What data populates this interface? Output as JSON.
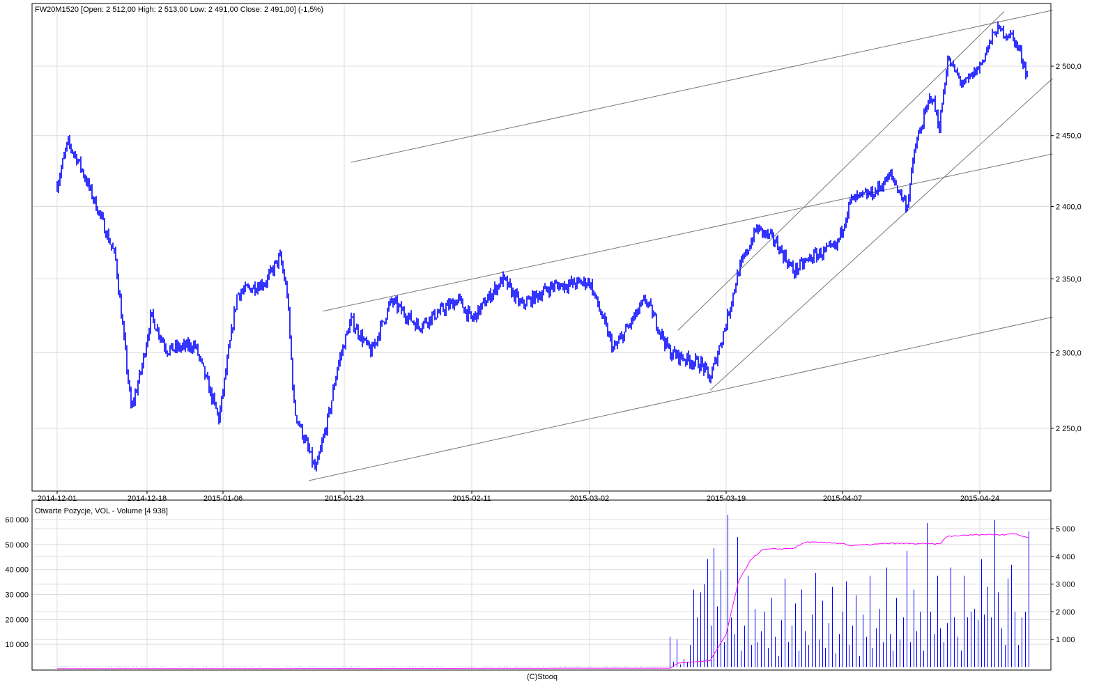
{
  "chart_data": [
    {
      "type": "candlestick",
      "title": "FW20M1520 [Open: 2 512,00  High: 2 513,00  Low: 2 491,00  Close: 2 491,00] (-1,5%)",
      "y_scale": "log",
      "ylim": [
        2210,
        2545
      ],
      "y_ticks": [
        {
          "v": 2500,
          "label": "2 500,0"
        },
        {
          "v": 2450,
          "label": "2 450,0"
        },
        {
          "v": 2400,
          "label": "2 400,0"
        },
        {
          "v": 2350,
          "label": "2 350,0"
        },
        {
          "v": 2300,
          "label": "2 300,0"
        },
        {
          "v": 2250,
          "label": "2 250,0"
        }
      ],
      "x_ticks": [
        "2014-12-01",
        "2014-12-18",
        "2015-01-06",
        "2015-01-23",
        "2015-02-11",
        "2015-03-02",
        "2015-03-19",
        "2015-04-07",
        "2015-04-24"
      ],
      "price_path": [
        [
          "2014-12-01",
          2415
        ],
        [
          "2014-12-03",
          2445
        ],
        [
          "2014-12-05",
          2432
        ],
        [
          "2014-12-09",
          2395
        ],
        [
          "2014-12-12",
          2365
        ],
        [
          "2014-12-15",
          2262
        ],
        [
          "2014-12-17",
          2290
        ],
        [
          "2014-12-19",
          2325
        ],
        [
          "2014-12-23",
          2302
        ],
        [
          "2014-12-30",
          2305
        ],
        [
          "2015-01-05",
          2256
        ],
        [
          "2015-01-08",
          2340
        ],
        [
          "2015-01-12",
          2348
        ],
        [
          "2015-01-14",
          2365
        ],
        [
          "2015-01-15",
          2340
        ],
        [
          "2015-01-16",
          2262
        ],
        [
          "2015-01-19",
          2222
        ],
        [
          "2015-01-21",
          2262
        ],
        [
          "2015-01-22",
          2290
        ],
        [
          "2015-01-24",
          2322
        ],
        [
          "2015-01-27",
          2300
        ],
        [
          "2015-01-30",
          2335
        ],
        [
          "2015-02-03",
          2318
        ],
        [
          "2015-02-09",
          2336
        ],
        [
          "2015-02-11",
          2322
        ],
        [
          "2015-02-16",
          2350
        ],
        [
          "2015-02-19",
          2332
        ],
        [
          "2015-02-24",
          2345
        ],
        [
          "2015-03-02",
          2348
        ],
        [
          "2015-03-05",
          2302
        ],
        [
          "2015-03-09",
          2336
        ],
        [
          "2015-03-12",
          2300
        ],
        [
          "2015-03-16",
          2292
        ],
        [
          "2015-03-17",
          2282
        ],
        [
          "2015-03-19",
          2320
        ],
        [
          "2015-03-21",
          2355
        ],
        [
          "2015-03-24",
          2385
        ],
        [
          "2015-03-27",
          2376
        ],
        [
          "2015-03-30",
          2355
        ],
        [
          "2015-04-02",
          2365
        ],
        [
          "2015-04-06",
          2372
        ],
        [
          "2015-04-08",
          2404
        ],
        [
          "2015-04-11",
          2410
        ],
        [
          "2015-04-13",
          2422
        ],
        [
          "2015-04-15",
          2400
        ],
        [
          "2015-04-16",
          2442
        ],
        [
          "2015-04-18",
          2480
        ],
        [
          "2015-04-19",
          2456
        ],
        [
          "2015-04-20",
          2505
        ],
        [
          "2015-04-22",
          2486
        ],
        [
          "2015-04-24",
          2500
        ],
        [
          "2015-04-26",
          2527
        ],
        [
          "2015-04-28",
          2522
        ],
        [
          "2015-04-29",
          2510
        ],
        [
          "2015-04-30",
          2491
        ]
      ],
      "trend_lines": [
        [
          [
            "2015-01-24",
            2431
          ],
          [
            "2015-05-03",
            2541
          ]
        ],
        [
          [
            "2015-01-20",
            2328
          ],
          [
            "2015-05-03",
            2437
          ]
        ],
        [
          [
            "2015-01-18",
            2216
          ],
          [
            "2015-05-03",
            2324
          ]
        ],
        [
          [
            "2015-03-13",
            2315
          ],
          [
            "2015-04-27",
            2540
          ]
        ],
        [
          [
            "2015-03-17",
            2275
          ],
          [
            "2015-05-03",
            2491
          ]
        ]
      ],
      "series_color": "#0000ff"
    },
    {
      "type": "bar+line",
      "title": "Otwarte Pozycje, VOL - Volume [4 938]",
      "left_axis": {
        "name": "Otwarte Pozycje",
        "ticks": [
          {
            "v": 60000,
            "label": "60 000"
          },
          {
            "v": 50000,
            "label": "50 000"
          },
          {
            "v": 40000,
            "label": "40 000"
          },
          {
            "v": 30000,
            "label": "30 000"
          },
          {
            "v": 20000,
            "label": "20 000"
          },
          {
            "v": 10000,
            "label": "10 000"
          }
        ]
      },
      "right_axis": {
        "name": "Volume",
        "ticks": [
          {
            "v": 5000,
            "label": "5 000"
          },
          {
            "v": 4000,
            "label": "4 000"
          },
          {
            "v": 3000,
            "label": "3 000"
          },
          {
            "v": 2000,
            "label": "2 000"
          },
          {
            "v": 1000,
            "label": "1 000"
          }
        ]
      },
      "volume_start": "2015-03-12",
      "volume_end": "2015-04-30",
      "volume": [
        1100,
        200,
        1000,
        100,
        300,
        200,
        800,
        2800,
        1800,
        2700,
        3000,
        3900,
        1500,
        4300,
        2200,
        3500,
        900,
        5500,
        1800,
        1200,
        4700,
        600,
        1500,
        3300,
        800,
        2100,
        900,
        1300,
        2000,
        700,
        2500,
        1100,
        400,
        1700,
        3200,
        900,
        1500,
        2300,
        600,
        2800,
        1300,
        800,
        1900,
        3400,
        1000,
        2400,
        700,
        1600,
        2900,
        500,
        1200,
        2000,
        3100,
        800,
        1500,
        2600,
        400,
        1900,
        1100,
        3300,
        700,
        1400,
        2100,
        900,
        3600,
        1200,
        600,
        2500,
        1000,
        1800,
        4200,
        900,
        2800,
        1300,
        2000,
        600,
        5200,
        2000,
        1200,
        3300,
        1400,
        900,
        1600,
        3600,
        1800,
        1100,
        600,
        3300,
        1800,
        2000,
        2100,
        1700,
        3900,
        1900,
        2900,
        1800,
        5300,
        2700,
        1400,
        800,
        3200,
        3700,
        2000,
        800,
        1800,
        2000,
        4900
      ],
      "open_interest": [
        [
          "2014-12-01",
          300
        ],
        [
          "2015-03-12",
          500
        ],
        [
          "2015-03-13",
          2500
        ],
        [
          "2015-03-17",
          3500
        ],
        [
          "2015-03-19",
          14000
        ],
        [
          "2015-03-21",
          35000
        ],
        [
          "2015-03-23",
          44000
        ],
        [
          "2015-03-25",
          48000
        ],
        [
          "2015-03-30",
          48500
        ],
        [
          "2015-04-01",
          51000
        ],
        [
          "2015-04-07",
          50500
        ],
        [
          "2015-04-08",
          49500
        ],
        [
          "2015-04-13",
          50500
        ],
        [
          "2015-04-19",
          50200
        ],
        [
          "2015-04-20",
          53300
        ],
        [
          "2015-04-24",
          54000
        ],
        [
          "2015-04-27",
          54000
        ],
        [
          "2015-04-28",
          54500
        ],
        [
          "2015-04-30",
          52800
        ]
      ],
      "volume_color": "#0000ff",
      "oi_color": "#ff00ff"
    }
  ],
  "footer": "(C)Stooq"
}
